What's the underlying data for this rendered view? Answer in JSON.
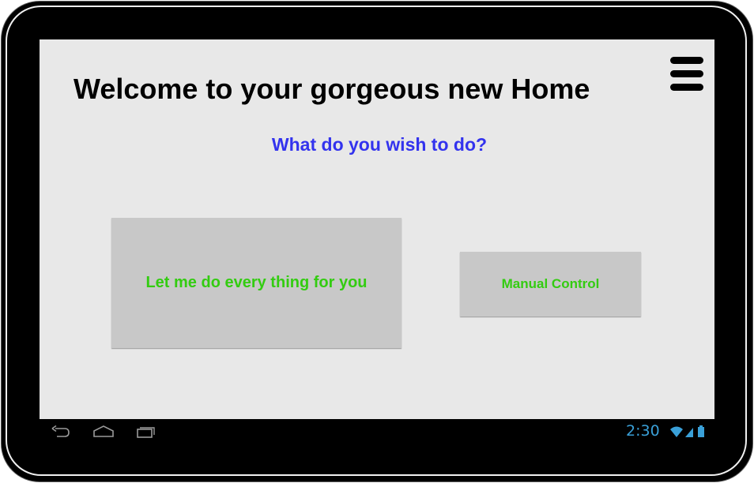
{
  "home": {
    "title": "Welcome to your gorgeous new Home",
    "prompt": "What do you wish to do?",
    "auto_button_label": "Let me do every thing for you",
    "manual_button_label": "Manual Control"
  },
  "status_bar": {
    "time": "2:30",
    "icons": [
      "wifi-icon",
      "signal-icon",
      "battery-icon"
    ]
  },
  "nav_bar": {
    "icons": [
      "back-icon",
      "home-icon",
      "recent-apps-icon"
    ]
  },
  "colors": {
    "title": "#000000",
    "prompt": "#3333ee",
    "button_text": "#33cc11",
    "button_bg": "#c8c8c8",
    "screen_bg": "#e8e8e8",
    "system_accent": "#3aa0d8"
  }
}
